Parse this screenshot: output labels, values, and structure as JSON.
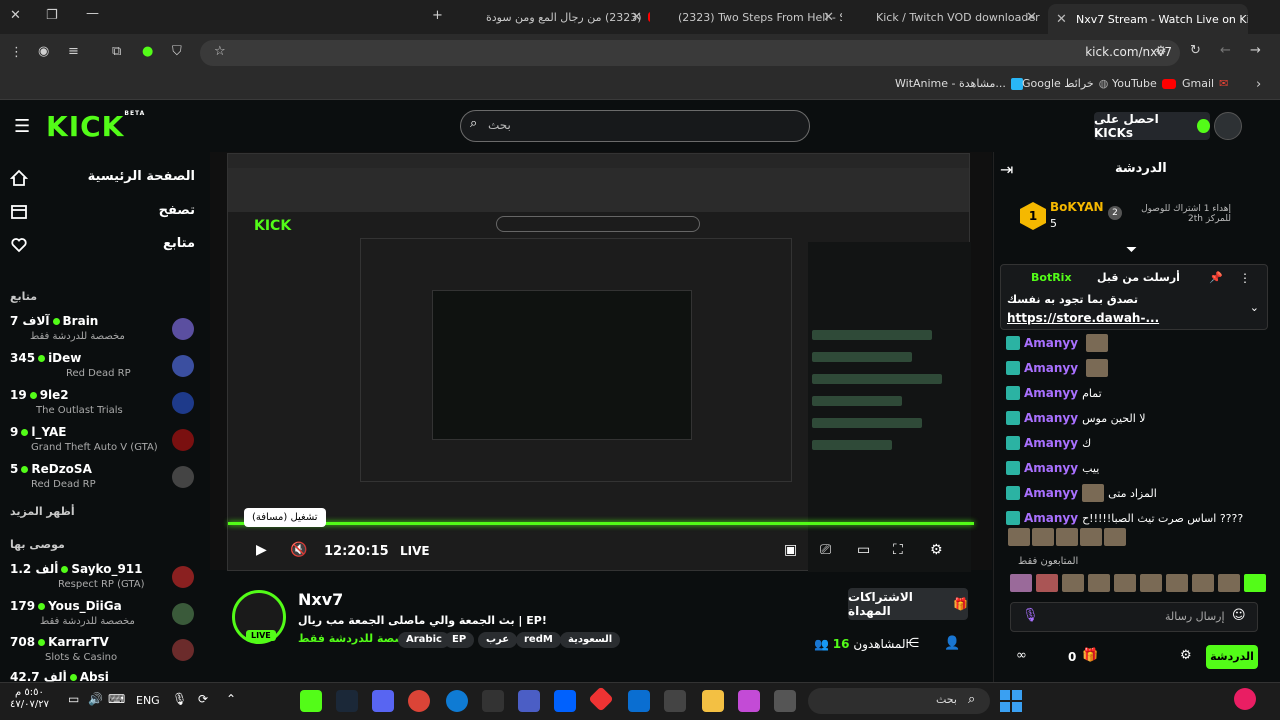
{
  "browser": {
    "tabs": [
      {
        "title": "(2323) من رجال المع ومن سودة",
        "icon": "youtube"
      },
      {
        "title": "(2323) Two Steps From Hell - St",
        "icon": "youtube"
      },
      {
        "title": "Kick / Twitch VOD downloader",
        "icon": "d-logo"
      },
      {
        "title": "Nxv7 Stream - Watch Live on Ki",
        "icon": "kick"
      }
    ],
    "url": "kick.com/nxv7",
    "bookmarks": [
      "WitAnime - مشاهدة...",
      "Google خرائط",
      "YouTube",
      "Gmail"
    ]
  },
  "header": {
    "logo": "KICK",
    "logo_sup": "BETA",
    "search_placeholder": "بحث",
    "get_kicks": "احصل على KICKs"
  },
  "sidebar": {
    "nav": [
      "الصفحة الرئيسية",
      "تصفح",
      "متابع"
    ],
    "following_title": "متابع",
    "channels": [
      {
        "name": "Brain",
        "viewers": "7 آلاف",
        "category": "مخصصة للدردشة فقط",
        "color": "#5b4fa0"
      },
      {
        "name": "iDew",
        "viewers": "345",
        "category": "Red Dead RP",
        "color": "#3b4fa0"
      },
      {
        "name": "9le2",
        "viewers": "19",
        "category": "The Outlast Trials",
        "color": "#1e3a8a"
      },
      {
        "name": "l_YAE",
        "viewers": "9",
        "category": "Grand Theft Auto V (GTA)",
        "color": "#7a1010"
      },
      {
        "name": "ReDzoSA",
        "viewers": "5",
        "category": "Red Dead RP",
        "color": "#444"
      }
    ],
    "show_more": "أظهر المزيد",
    "recommended_title": "موصى بها",
    "recommended": [
      {
        "name": "Sayko_911",
        "viewers": "1.2 ألف",
        "category": "Respect RP (GTA)",
        "color": "#8a2020"
      },
      {
        "name": "Yous_DiiGa",
        "viewers": "179",
        "category": "مخصصة للدردشة فقط",
        "color": "#3a5a3a"
      },
      {
        "name": "KarrarTV",
        "viewers": "708",
        "category": "Slots & Casino",
        "color": "#6b2b2b"
      },
      {
        "name": "Absi",
        "viewers": "42.7 ألف",
        "category": "",
        "color": "#333"
      }
    ]
  },
  "player": {
    "tooltip": "تشغيل (مسافة)",
    "time": "12:20:15",
    "live": "LIVE"
  },
  "stream": {
    "streamer": "Nxv7",
    "live_badge": "LIVE",
    "title": "بث الجمعة والي ماصلى الجمعة مب ريال | EP!",
    "category": "مخصصة للدردشة فقط",
    "tags": [
      "السعودية",
      "redM",
      "عرب",
      "EP",
      "Arabic"
    ],
    "subscriptions_btn": "الاشتراكات المهداة",
    "viewers_label": "المشاهدون",
    "viewers_count": "16"
  },
  "chat": {
    "title": "الدردشة",
    "gifter_name": "BoKYAN",
    "gifter_count": "5",
    "gifter_note": "إهداء 1 اشتراك للوصول للمركز 2th",
    "gifter_rank": "2",
    "pinned_by_label": "أرسلت من قبل",
    "pinned_user": "BotRix",
    "pinned_text": "تصدق بما تجود به نفسك",
    "pinned_link": "https://store.dawah-...",
    "messages": [
      {
        "user": "Amanyy",
        "text": ""
      },
      {
        "user": "Amanyy",
        "text": ""
      },
      {
        "user": "Amanyy",
        "text": "تمام"
      },
      {
        "user": "Amanyy",
        "text": "لا الحين موس"
      },
      {
        "user": "Amanyy",
        "text": "ك"
      },
      {
        "user": "Amanyy",
        "text": "ييب"
      },
      {
        "user": "Amanyy",
        "text": "المزاد متى"
      },
      {
        "user": "Amanyy",
        "text": "اساس صرت تيث الصبا!!!!!ح ????"
      }
    ],
    "subscribers_only": "المتابعون فقط",
    "input_placeholder": "إرسال رسالة",
    "send_button": "الدردشة",
    "points": "0"
  },
  "taskbar": {
    "search_placeholder": "بحث",
    "lang": "ENG",
    "clock_time": "٥:٥٠ م",
    "clock_date": "٤٧/٠٧/٢٧"
  }
}
